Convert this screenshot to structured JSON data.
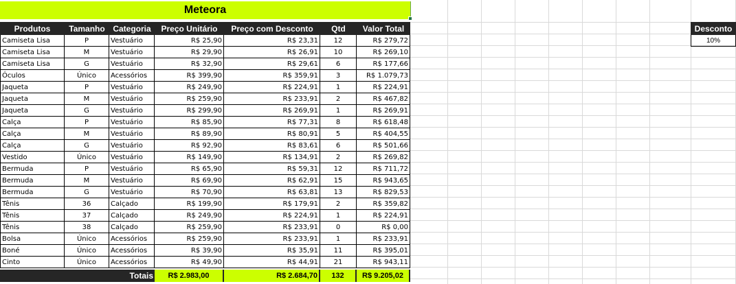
{
  "sheet_title": "Meteora",
  "headers": [
    "Produtos",
    "Tamanho",
    "Categoria",
    "Preço Unitário",
    "Preço com Desconto",
    "Qtd",
    "Valor Total"
  ],
  "rows": [
    [
      "Camiseta Lisa",
      "P",
      "Vestuário",
      "R$ 25,90",
      "R$ 23,31",
      "12",
      "R$ 279,72"
    ],
    [
      "Camiseta Lisa",
      "M",
      "Vestuário",
      "R$ 29,90",
      "R$ 26,91",
      "10",
      "R$ 269,10"
    ],
    [
      "Camiseta Lisa",
      "G",
      "Vestuário",
      "R$ 32,90",
      "R$ 29,61",
      "6",
      "R$ 177,66"
    ],
    [
      "Óculos",
      "Único",
      "Acessórios",
      "R$ 399,90",
      "R$ 359,91",
      "3",
      "R$ 1.079,73"
    ],
    [
      "Jaqueta",
      "P",
      "Vestuário",
      "R$ 249,90",
      "R$ 224,91",
      "1",
      "R$ 224,91"
    ],
    [
      "Jaqueta",
      "M",
      "Vestuário",
      "R$ 259,90",
      "R$ 233,91",
      "2",
      "R$ 467,82"
    ],
    [
      "Jaqueta",
      "G",
      "Vestuário",
      "R$ 299,90",
      "R$ 269,91",
      "1",
      "R$ 269,91"
    ],
    [
      "Calça",
      "P",
      "Vestuário",
      "R$ 85,90",
      "R$ 77,31",
      "8",
      "R$ 618,48"
    ],
    [
      "Calça",
      "M",
      "Vestuário",
      "R$ 89,90",
      "R$ 80,91",
      "5",
      "R$ 404,55"
    ],
    [
      "Calça",
      "G",
      "Vestuário",
      "R$ 92,90",
      "R$ 83,61",
      "6",
      "R$ 501,66"
    ],
    [
      "Vestido",
      "Único",
      "Vestuário",
      "R$ 149,90",
      "R$ 134,91",
      "2",
      "R$ 269,82"
    ],
    [
      "Bermuda",
      "P",
      "Vestuário",
      "R$ 65,90",
      "R$ 59,31",
      "12",
      "R$ 711,72"
    ],
    [
      "Bermuda",
      "M",
      "Vestuário",
      "R$ 69,90",
      "R$ 62,91",
      "15",
      "R$ 943,65"
    ],
    [
      "Bermuda",
      "G",
      "Vestuário",
      "R$ 70,90",
      "R$ 63,81",
      "13",
      "R$ 829,53"
    ],
    [
      "Tênis",
      "36",
      "Calçado",
      "R$ 199,90",
      "R$ 179,91",
      "2",
      "R$ 359,82"
    ],
    [
      "Tênis",
      "37",
      "Calçado",
      "R$ 249,90",
      "R$ 224,91",
      "1",
      "R$ 224,91"
    ],
    [
      "Tênis",
      "38",
      "Calçado",
      "R$ 259,90",
      "R$ 233,91",
      "0",
      "R$ 0,00"
    ],
    [
      "Bolsa",
      "Único",
      "Acessórios",
      "R$ 259,90",
      "R$ 233,91",
      "1",
      "R$ 233,91"
    ],
    [
      "Boné",
      "Único",
      "Acessórios",
      "R$ 39,90",
      "R$ 35,91",
      "11",
      "R$ 395,01"
    ],
    [
      "Cinto",
      "Único",
      "Acessórios",
      "R$ 49,90",
      "R$ 44,91",
      "21",
      "R$ 943,11"
    ]
  ],
  "totals": {
    "label": "Totais",
    "preco_unitario": "R$ 2.983,00",
    "preco_desconto": "R$ 2.684,70",
    "qtd": "132",
    "valor_total": "R$ 9.205,02"
  },
  "discount": {
    "header": "Desconto",
    "value": "10%"
  },
  "colors": {
    "accent_green": "#ccff00",
    "header_dark": "#262626"
  }
}
